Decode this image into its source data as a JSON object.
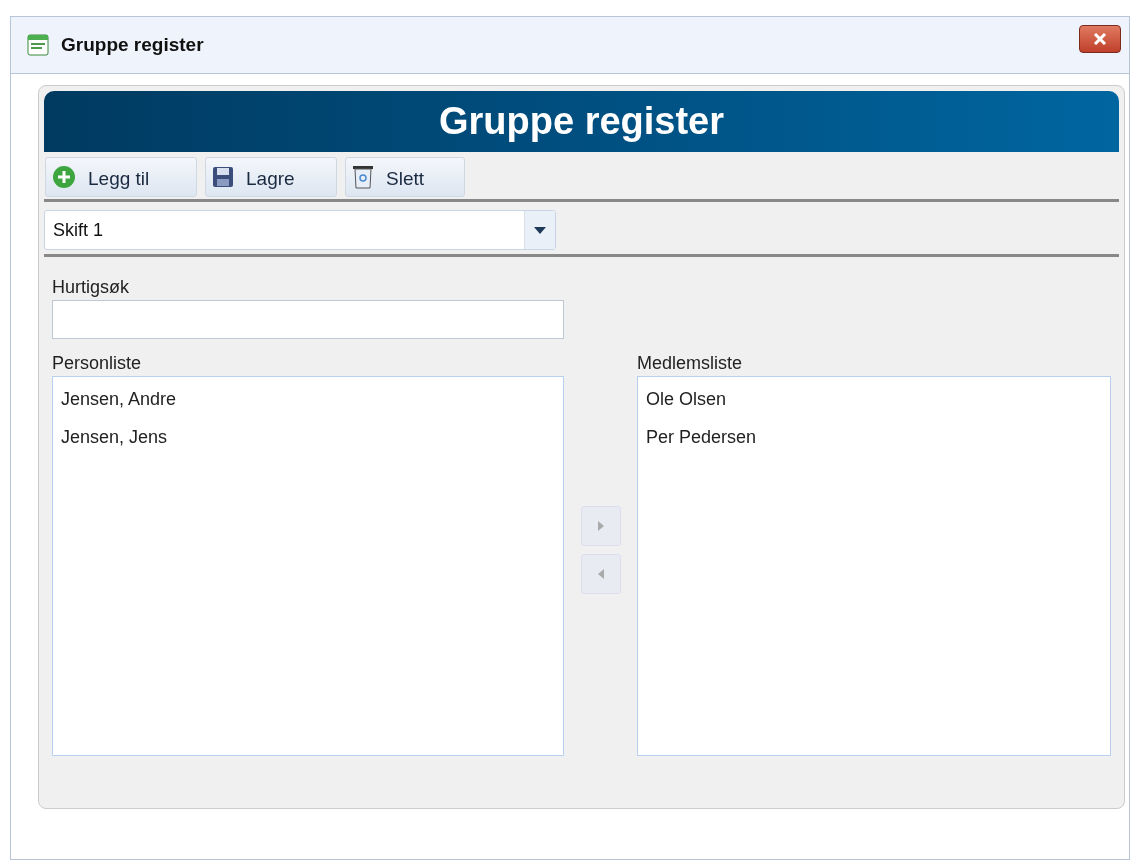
{
  "window": {
    "title": "Gruppe register"
  },
  "header": {
    "title": "Gruppe register"
  },
  "toolbar": [
    {
      "kind": "add",
      "label": "Legg til"
    },
    {
      "kind": "save",
      "label": "Lagre"
    },
    {
      "kind": "delete",
      "label": "Slett"
    }
  ],
  "group_select": {
    "value": "Skift 1"
  },
  "quick_search": {
    "label": "Hurtigsøk"
  },
  "person_list": {
    "label": "Personliste",
    "items": [
      "Jensen, Andre",
      "Jensen, Jens"
    ]
  },
  "move_buttons": [
    {
      "kind": "right",
      "disabled": true
    },
    {
      "kind": "left",
      "disabled": true
    }
  ],
  "member_list": {
    "label": "Medlemsliste",
    "items": [
      "Ole Olsen",
      "Per Pedersen"
    ]
  }
}
